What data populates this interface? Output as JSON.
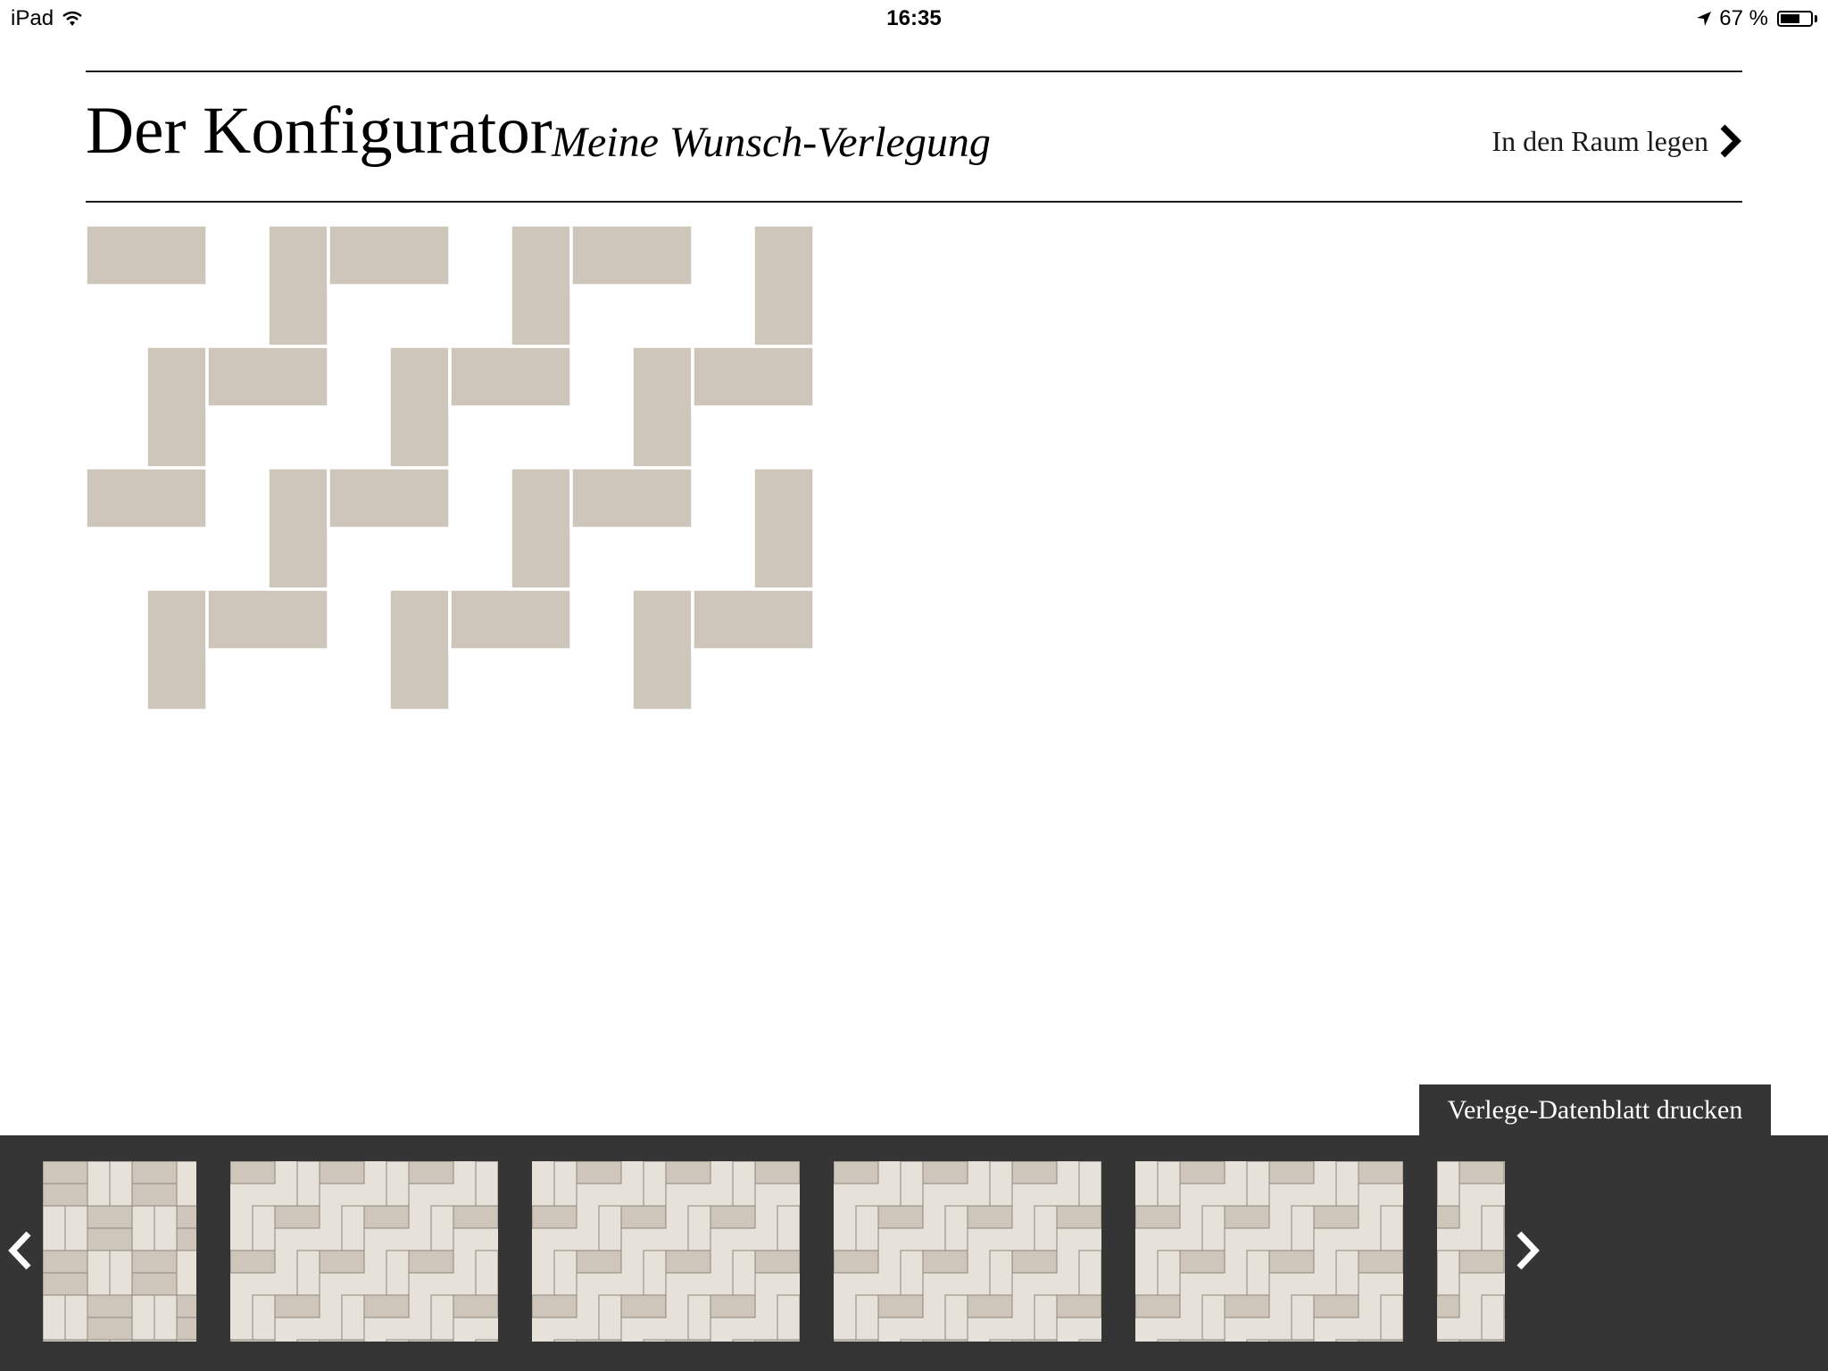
{
  "status_bar": {
    "device": "iPad",
    "time": "16:35",
    "battery_text": "67 %",
    "battery_level": 0.67,
    "icons": [
      "wifi-icon",
      "location-arrow-icon",
      "battery-icon"
    ]
  },
  "header": {
    "title": "Der Konfigurator",
    "subtitle": "Meine Wunsch-Verlegung",
    "room_link_label": "In den Raum legen"
  },
  "preview": {
    "pattern": "herringbone",
    "tile_color": "#cec6bb",
    "joint_color": "#ffffff"
  },
  "print_button_label": "Verlege-Datenblatt drucken",
  "carousel": {
    "prev_icon": "chevron-left-icon",
    "next_icon": "chevron-right-icon",
    "thumbnails": [
      {
        "pattern": "basketweave"
      },
      {
        "pattern": "herringbone-mixed"
      },
      {
        "pattern": "herringbone-mixed"
      },
      {
        "pattern": "herringbone-mixed"
      },
      {
        "pattern": "herringbone-mixed"
      },
      {
        "pattern": "herringbone-mixed"
      }
    ],
    "colors": {
      "light": "#e6e1d9",
      "dark": "#cec6bb",
      "line": "#8f877c",
      "background": "#353535"
    }
  }
}
